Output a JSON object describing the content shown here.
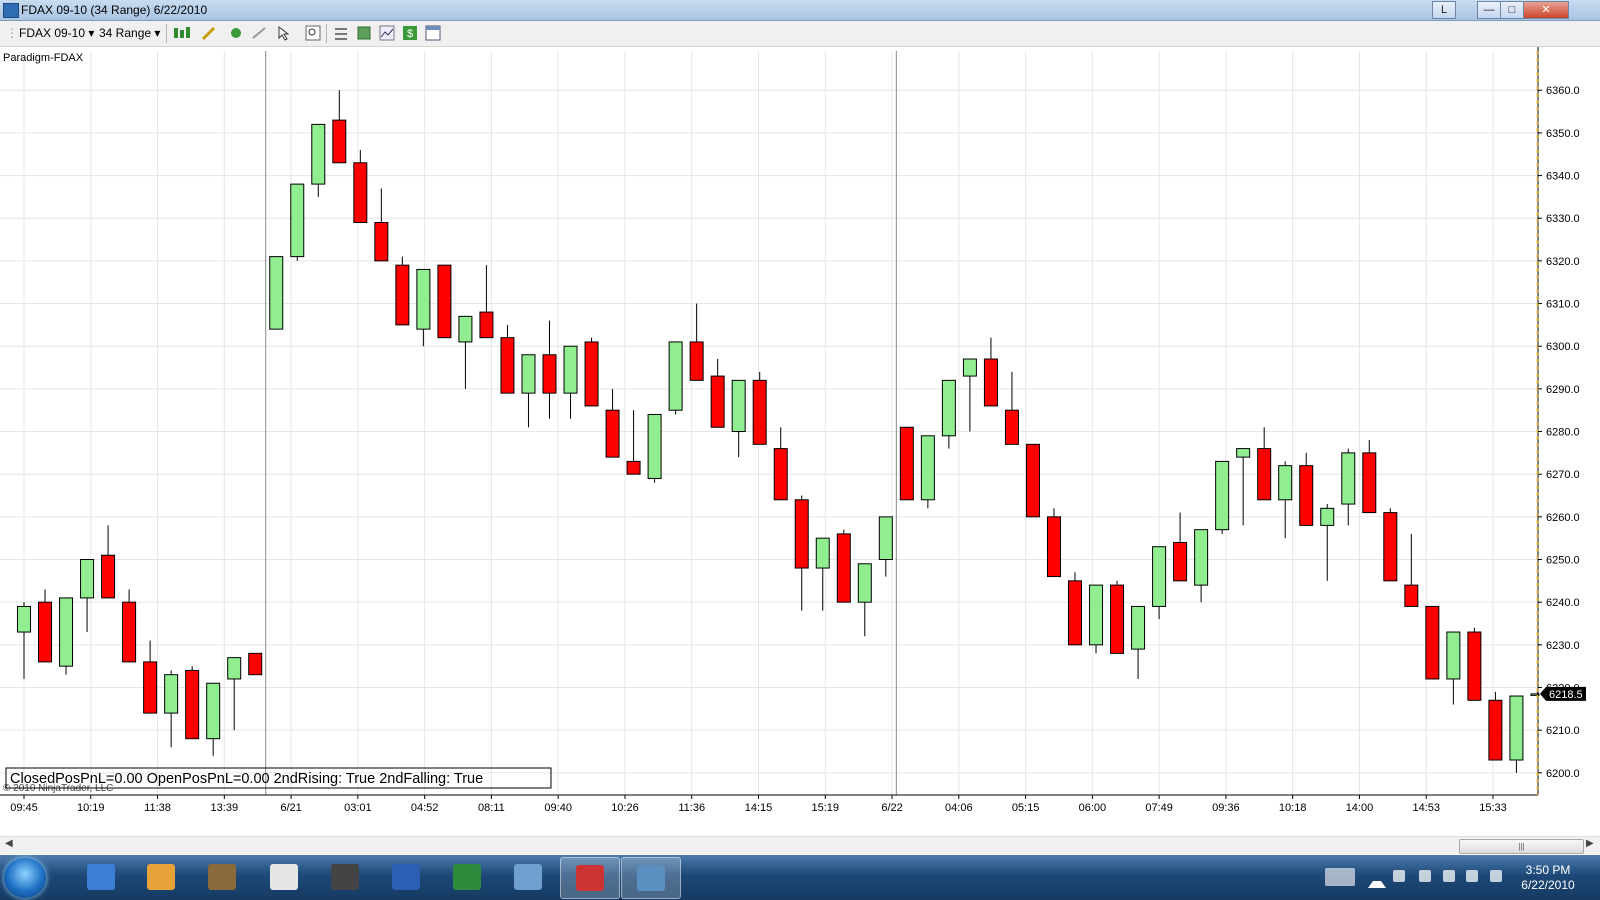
{
  "window": {
    "title": "FDAX 09-10 (34 Range)  6/22/2010",
    "login_label": "L"
  },
  "toolbar": {
    "instrument": "FDAX 09-10",
    "bar_type": "34 Range"
  },
  "chart": {
    "panel_label": "Paradigm-FDAX",
    "copyright": "© 2010 NinjaTrader, LLC",
    "status_text": "ClosedPosPnL=0.00 OpenPosPnL=0.00 2ndRising: True 2ndFalling: True",
    "last_price_label": "6218.5",
    "colors": {
      "up": "#90ee90",
      "down": "#ff0000",
      "grid": "#e6e6e6",
      "last_price_line": "#daa520"
    }
  },
  "chart_data": {
    "type": "candlestick",
    "title": "FDAX 09-10 (34 Range)",
    "y_ticks": [
      "6200.0",
      "6210.0",
      "6220.0",
      "6230.0",
      "6240.0",
      "6250.0",
      "6260.0",
      "6270.0",
      "6280.0",
      "6290.0",
      "6300.0",
      "6310.0",
      "6320.0",
      "6330.0",
      "6340.0",
      "6350.0",
      "6360.0"
    ],
    "ylim": [
      6194.8,
      6369.2
    ],
    "x_ticks": [
      "09:45",
      "10:19",
      "11:38",
      "13:39",
      "6/21",
      "03:01",
      "04:52",
      "08:11",
      "09:40",
      "10:26",
      "11:36",
      "14:15",
      "15:19",
      "6/22",
      "04:06",
      "05:15",
      "06:00",
      "07:49",
      "09:36",
      "10:18",
      "14:00",
      "14:53",
      "15:33"
    ],
    "session_breaks_after_candle": [
      11,
      41
    ],
    "candles": [
      {
        "o": 6233,
        "h": 6240,
        "l": 6222,
        "c": 6239
      },
      {
        "o": 6240,
        "h": 6243,
        "l": 6226,
        "c": 6226
      },
      {
        "o": 6225,
        "h": 6241,
        "l": 6223,
        "c": 6241
      },
      {
        "o": 6241,
        "h": 6250,
        "l": 6233,
        "c": 6250
      },
      {
        "o": 6251,
        "h": 6258,
        "l": 6241,
        "c": 6241
      },
      {
        "o": 6240,
        "h": 6243,
        "l": 6226,
        "c": 6226
      },
      {
        "o": 6226,
        "h": 6231,
        "l": 6214,
        "c": 6214
      },
      {
        "o": 6214,
        "h": 6224,
        "l": 6206,
        "c": 6223
      },
      {
        "o": 6224,
        "h": 6225,
        "l": 6208,
        "c": 6208
      },
      {
        "o": 6208,
        "h": 6221,
        "l": 6204,
        "c": 6221
      },
      {
        "o": 6222,
        "h": 6227,
        "l": 6210,
        "c": 6227
      },
      {
        "o": 6228,
        "h": 6228,
        "l": 6223,
        "c": 6223
      },
      {
        "o": 6304,
        "h": 6321,
        "l": 6304,
        "c": 6321
      },
      {
        "o": 6321,
        "h": 6338,
        "l": 6320,
        "c": 6338
      },
      {
        "o": 6338,
        "h": 6352,
        "l": 6335,
        "c": 6352
      },
      {
        "o": 6353,
        "h": 6360,
        "l": 6343,
        "c": 6343
      },
      {
        "o": 6343,
        "h": 6346,
        "l": 6329,
        "c": 6329
      },
      {
        "o": 6329,
        "h": 6337,
        "l": 6320,
        "c": 6320
      },
      {
        "o": 6319,
        "h": 6321,
        "l": 6305,
        "c": 6305
      },
      {
        "o": 6304,
        "h": 6318,
        "l": 6300,
        "c": 6318
      },
      {
        "o": 6319,
        "h": 6319,
        "l": 6302,
        "c": 6302
      },
      {
        "o": 6301,
        "h": 6307,
        "l": 6290,
        "c": 6307
      },
      {
        "o": 6308,
        "h": 6319,
        "l": 6302,
        "c": 6302
      },
      {
        "o": 6302,
        "h": 6305,
        "l": 6289,
        "c": 6289
      },
      {
        "o": 6289,
        "h": 6298,
        "l": 6281,
        "c": 6298
      },
      {
        "o": 6298,
        "h": 6306,
        "l": 6283,
        "c": 6289
      },
      {
        "o": 6289,
        "h": 6300,
        "l": 6283,
        "c": 6300
      },
      {
        "o": 6301,
        "h": 6302,
        "l": 6286,
        "c": 6286
      },
      {
        "o": 6285,
        "h": 6290,
        "l": 6274,
        "c": 6274
      },
      {
        "o": 6273,
        "h": 6285,
        "l": 6270,
        "c": 6270
      },
      {
        "o": 6269,
        "h": 6284,
        "l": 6268,
        "c": 6284
      },
      {
        "o": 6285,
        "h": 6301,
        "l": 6284,
        "c": 6301
      },
      {
        "o": 6301,
        "h": 6310,
        "l": 6292,
        "c": 6292
      },
      {
        "o": 6293,
        "h": 6297,
        "l": 6281,
        "c": 6281
      },
      {
        "o": 6280,
        "h": 6292,
        "l": 6274,
        "c": 6292
      },
      {
        "o": 6292,
        "h": 6294,
        "l": 6277,
        "c": 6277
      },
      {
        "o": 6276,
        "h": 6281,
        "l": 6264,
        "c": 6264
      },
      {
        "o": 6264,
        "h": 6265,
        "l": 6238,
        "c": 6248
      },
      {
        "o": 6248,
        "h": 6255,
        "l": 6238,
        "c": 6255
      },
      {
        "o": 6256,
        "h": 6257,
        "l": 6240,
        "c": 6240
      },
      {
        "o": 6240,
        "h": 6248,
        "l": 6232,
        "c": 6249
      },
      {
        "o": 6250,
        "h": 6260,
        "l": 6246,
        "c": 6260
      },
      {
        "o": 6281,
        "h": 6281,
        "l": 6264,
        "c": 6264
      },
      {
        "o": 6264,
        "h": 6279,
        "l": 6262,
        "c": 6279
      },
      {
        "o": 6279,
        "h": 6292,
        "l": 6276,
        "c": 6292
      },
      {
        "o": 6293,
        "h": 6297,
        "l": 6280,
        "c": 6297
      },
      {
        "o": 6297,
        "h": 6302,
        "l": 6286,
        "c": 6286
      },
      {
        "o": 6285,
        "h": 6294,
        "l": 6277,
        "c": 6277
      },
      {
        "o": 6277,
        "h": 6277,
        "l": 6260,
        "c": 6260
      },
      {
        "o": 6260,
        "h": 6262,
        "l": 6246,
        "c": 6246
      },
      {
        "o": 6245,
        "h": 6247,
        "l": 6230,
        "c": 6230
      },
      {
        "o": 6230,
        "h": 6243,
        "l": 6228,
        "c": 6244
      },
      {
        "o": 6244,
        "h": 6245,
        "l": 6228,
        "c": 6228
      },
      {
        "o": 6229,
        "h": 6239,
        "l": 6222,
        "c": 6239
      },
      {
        "o": 6239,
        "h": 6253,
        "l": 6236,
        "c": 6253
      },
      {
        "o": 6254,
        "h": 6261,
        "l": 6245,
        "c": 6245
      },
      {
        "o": 6244,
        "h": 6257,
        "l": 6240,
        "c": 6257
      },
      {
        "o": 6257,
        "h": 6273,
        "l": 6256,
        "c": 6273
      },
      {
        "o": 6274,
        "h": 6276,
        "l": 6258,
        "c": 6276
      },
      {
        "o": 6276,
        "h": 6281,
        "l": 6264,
        "c": 6264
      },
      {
        "o": 6264,
        "h": 6273,
        "l": 6255,
        "c": 6272
      },
      {
        "o": 6272,
        "h": 6275,
        "l": 6258,
        "c": 6258
      },
      {
        "o": 6258,
        "h": 6263,
        "l": 6245,
        "c": 6262
      },
      {
        "o": 6263,
        "h": 6276,
        "l": 6258,
        "c": 6275
      },
      {
        "o": 6275,
        "h": 6278,
        "l": 6262,
        "c": 6261
      },
      {
        "o": 6261,
        "h": 6262,
        "l": 6245,
        "c": 6245
      },
      {
        "o": 6244,
        "h": 6256,
        "l": 6239,
        "c": 6239
      },
      {
        "o": 6239,
        "h": 6239,
        "l": 6222,
        "c": 6222
      },
      {
        "o": 6222,
        "h": 6233,
        "l": 6216,
        "c": 6233
      },
      {
        "o": 6233,
        "h": 6234,
        "l": 6217,
        "c": 6217
      },
      {
        "o": 6217,
        "h": 6219,
        "l": 6203,
        "c": 6203
      },
      {
        "o": 6203,
        "h": 6218,
        "l": 6200,
        "c": 6218
      },
      {
        "o": 6218.5,
        "h": 6219,
        "l": 6218,
        "c": 6218.5
      }
    ]
  },
  "taskbar": {
    "apps": [
      "internet-explorer",
      "media-player",
      "ninjatrader-dice",
      "ninjatrader-control",
      "camera",
      "word",
      "excel",
      "network-tool",
      "ninjatrader-active",
      "chart-window"
    ],
    "clock_time": "3:50 PM",
    "clock_date": "6/22/2010"
  }
}
